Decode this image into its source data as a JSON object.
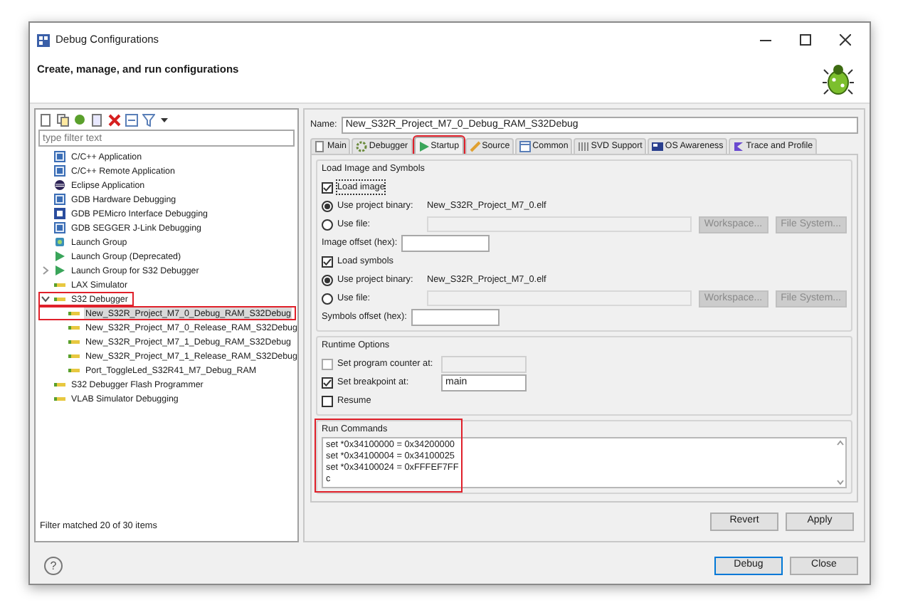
{
  "window": {
    "title": "Debug Configurations"
  },
  "header": {
    "title": "Create, manage, and run configurations"
  },
  "left_panel": {
    "filter": {
      "placeholder": "type filter text"
    },
    "tree": [
      {
        "label": "C/C++ Application",
        "kind": "c"
      },
      {
        "label": "C/C++ Remote Application",
        "kind": "c"
      },
      {
        "label": "Eclipse Application",
        "kind": "eclipse"
      },
      {
        "label": "GDB Hardware Debugging",
        "kind": "c"
      },
      {
        "label": "GDB PEMicro Interface Debugging",
        "kind": "pemicro"
      },
      {
        "label": "GDB SEGGER J-Link Debugging",
        "kind": "c"
      },
      {
        "label": "Launch Group",
        "kind": "group"
      },
      {
        "label": "Launch Group (Deprecated)",
        "kind": "play"
      },
      {
        "label": "Launch Group for S32 Debugger",
        "kind": "play",
        "expanded": false
      },
      {
        "label": "LAX Simulator",
        "kind": "launch"
      },
      {
        "label": "S32 Debugger",
        "kind": "launch",
        "expanded": true,
        "highlighted": true,
        "children": [
          {
            "label": "New_S32R_Project_M7_0_Debug_RAM_S32Debug",
            "kind": "launch",
            "selected": true,
            "highlighted": true
          },
          {
            "label": "New_S32R_Project_M7_0_Release_RAM_S32Debug",
            "kind": "launch",
            "selected": false,
            "highlighted": false
          },
          {
            "label": "New_S32R_Project_M7_1_Debug_RAM_S32Debug",
            "kind": "launch",
            "selected": false,
            "highlighted": false
          },
          {
            "label": "New_S32R_Project_M7_1_Release_RAM_S32Debug",
            "kind": "launch",
            "selected": false,
            "highlighted": false
          },
          {
            "label": "Port_ToggleLed_S32R41_M7_Debug_RAM",
            "kind": "launch",
            "selected": false,
            "highlighted": false
          }
        ]
      },
      {
        "label": "S32 Debugger Flash Programmer",
        "kind": "launch"
      },
      {
        "label": "VLAB Simulator Debugging",
        "kind": "launch"
      }
    ],
    "status": "Filter matched 20 of 30 items"
  },
  "right_panel": {
    "name_label": "Name:",
    "name_value": "New_S32R_Project_M7_0_Debug_RAM_S32Debug",
    "tabs": [
      {
        "label": "Main",
        "selected": false,
        "highlighted": false
      },
      {
        "label": "Debugger",
        "selected": false,
        "highlighted": false
      },
      {
        "label": "Startup",
        "selected": true,
        "highlighted": true
      },
      {
        "label": "Source",
        "selected": false,
        "highlighted": false
      },
      {
        "label": "Common",
        "selected": false,
        "highlighted": false
      },
      {
        "label": "SVD Support",
        "selected": false,
        "highlighted": false
      },
      {
        "label": "OS Awareness",
        "selected": false,
        "highlighted": false
      },
      {
        "label": "Trace and Profile",
        "selected": false,
        "highlighted": false
      }
    ],
    "groups": [
      {
        "title": "Load Image and Symbols",
        "rows": [
          {
            "kind": "checkbox",
            "label": "Load image",
            "checked": true
          },
          {
            "kind": "radio",
            "label": "Use project binary:",
            "selected": true,
            "value": "New_S32R_Project_M7_0.elf"
          },
          {
            "kind": "file",
            "label": "Use file:",
            "selected": false,
            "buttons": [
              {
                "label": "Workspace...",
                "disabled": true
              },
              {
                "label": "File System...",
                "disabled": true
              }
            ]
          },
          {
            "kind": "offset",
            "label": "Image offset (hex):"
          },
          {
            "kind": "checkbox",
            "label": "Load symbols",
            "checked": true
          },
          {
            "kind": "radio",
            "label": "Use project binary:",
            "selected": true,
            "value": "New_S32R_Project_M7_0.elf"
          },
          {
            "kind": "file",
            "label": "Use file:",
            "selected": false,
            "buttons": [
              {
                "label": "Workspace...",
                "disabled": true
              },
              {
                "label": "File System...",
                "disabled": true
              }
            ]
          },
          {
            "kind": "offset",
            "label": "Symbols offset (hex):"
          }
        ]
      },
      {
        "title": "Runtime Options",
        "rows": [
          {
            "kind": "checkbox-field",
            "label": "Set program counter at:",
            "checked": false,
            "disabled": true
          },
          {
            "kind": "checkbox-field",
            "label": "Set breakpoint at:",
            "checked": true,
            "disabled": false,
            "value": "main"
          },
          {
            "kind": "checkbox",
            "label": "Resume",
            "checked": false
          }
        ]
      }
    ],
    "run_commands": {
      "title": "Run Commands",
      "highlighted": true,
      "lines": [
        "set *0x34100000 = 0x34200000",
        "set *0x34100004 = 0x34100025",
        "set *0x34100024 = 0xFFFEF7FF",
        "c"
      ]
    },
    "buttons": [
      "Revert",
      "Apply"
    ]
  },
  "footer": {
    "help": "?",
    "buttons": [
      {
        "label": "Debug",
        "default": true
      },
      {
        "label": "Close",
        "default": false
      }
    ]
  }
}
